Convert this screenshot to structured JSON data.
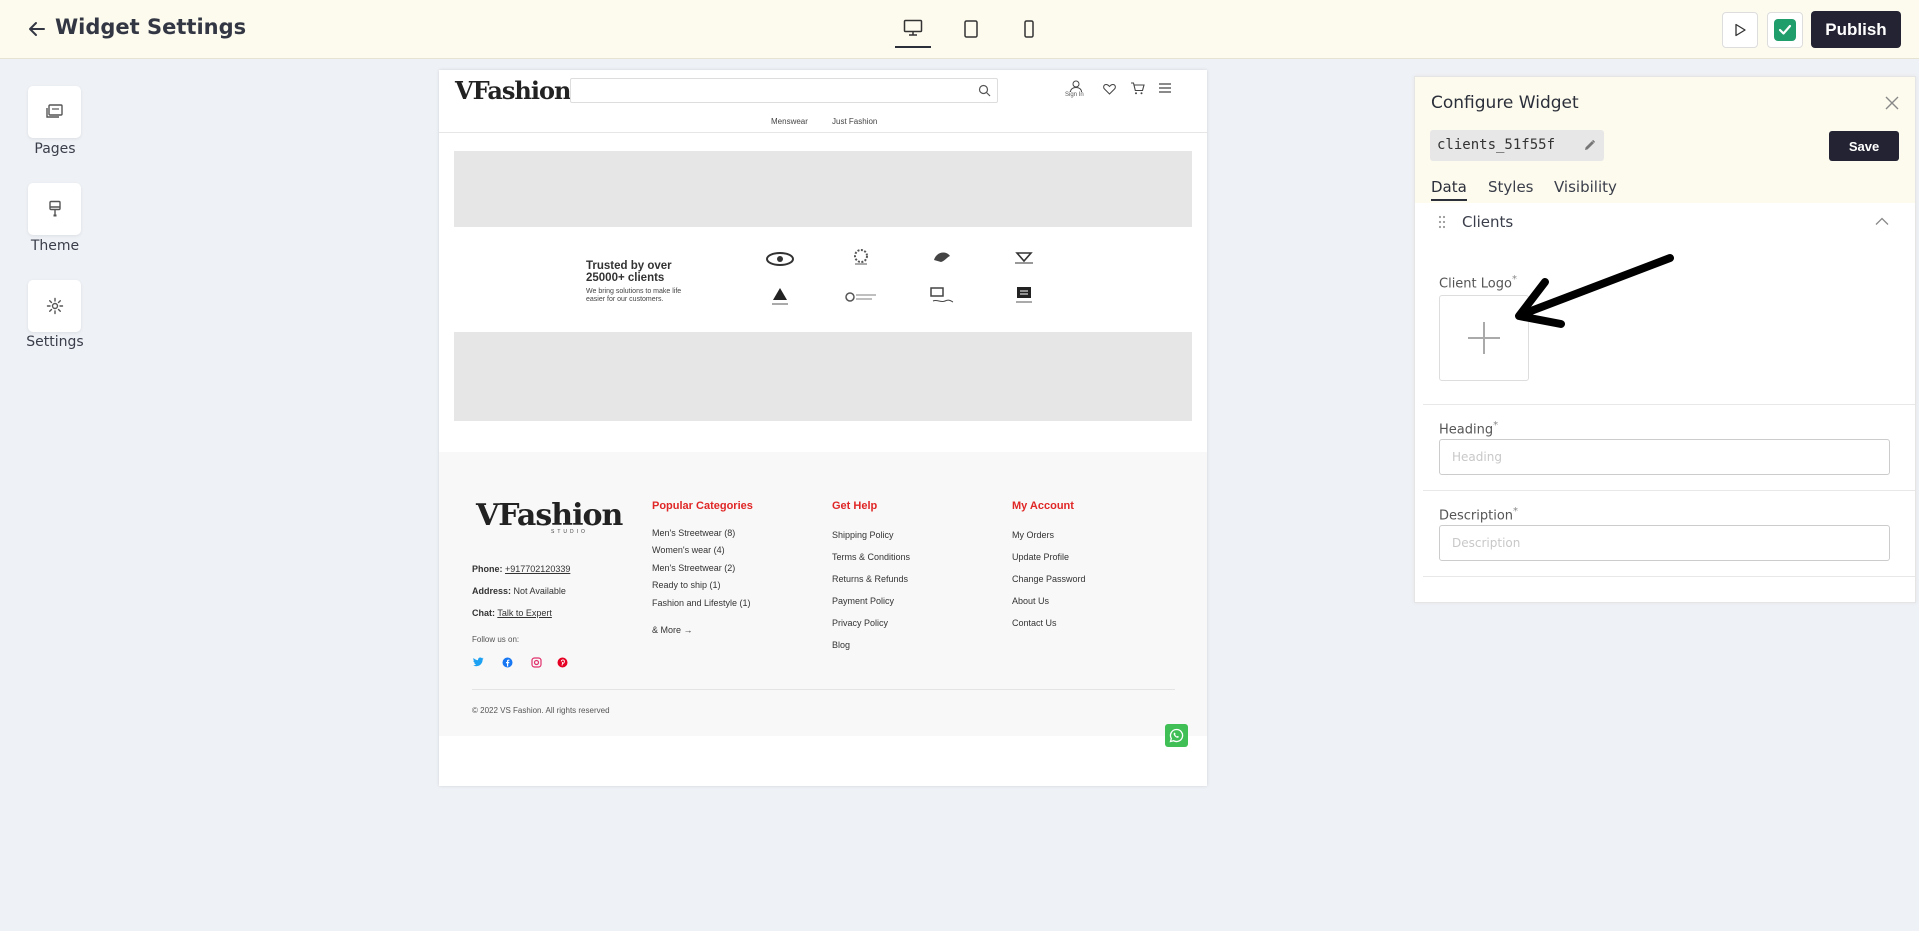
{
  "topbar": {
    "title": "Widget Settings",
    "devices": [
      "desktop-icon",
      "tablet-icon",
      "mobile-icon"
    ],
    "active_device": "desktop",
    "publish_label": "Publish"
  },
  "sidebar": {
    "items": [
      {
        "label": "Pages",
        "icon": "pages-icon"
      },
      {
        "label": "Theme",
        "icon": "brush-icon"
      },
      {
        "label": "Settings",
        "icon": "gear-icon"
      }
    ]
  },
  "site": {
    "logo": "VFashion",
    "logo_sub": "STUDIO",
    "signin": "Sign In",
    "nav": [
      "Menswear",
      "Just Fashion"
    ],
    "clients": {
      "heading_line1": "Trusted by over",
      "heading_line2": "25000+ clients",
      "sub": "We bring solutions to make life easier for our customers."
    },
    "footer": {
      "phone_label": "Phone:",
      "phone": "+917702120339",
      "address_label": "Address:",
      "address": "Not Available",
      "chat_label": "Chat:",
      "chat": "Talk to Expert",
      "follow": "Follow us on:",
      "col1_title": "Popular Categories",
      "col1": [
        "Men's Streetwear (8)",
        "Women's wear (4)",
        "Men's Streetwear (2)",
        "Ready to ship (1)",
        "Fashion and Lifestyle (1)"
      ],
      "more": "& More",
      "col2_title": "Get Help",
      "col2": [
        "Shipping Policy",
        "Terms & Conditions",
        "Returns & Refunds",
        "Payment Policy",
        "Privacy Policy",
        "Blog"
      ],
      "col3_title": "My Account",
      "col3": [
        "My Orders",
        "Update Profile",
        "Change Password",
        "About Us",
        "Contact Us"
      ],
      "copyright": "© 2022 VS Fashion. All rights reserved"
    }
  },
  "panel": {
    "title": "Configure Widget",
    "widget_name": "clients_51f55f",
    "save_label": "Save",
    "tabs": [
      "Data",
      "Styles",
      "Visibility"
    ],
    "active_tab": "Data",
    "section_title": "Clients",
    "client_logo_label": "Client Logo",
    "required_mark": "*",
    "heading_label": "Heading",
    "heading_placeholder": "Heading",
    "description_label": "Description",
    "description_placeholder": "Description"
  },
  "colors": {
    "topbar_bg": "#fdfbee",
    "publish_bg": "#232333",
    "accent_red": "#e02626",
    "check_green": "#1f9d6b",
    "whatsapp_green": "#3fbf56"
  }
}
